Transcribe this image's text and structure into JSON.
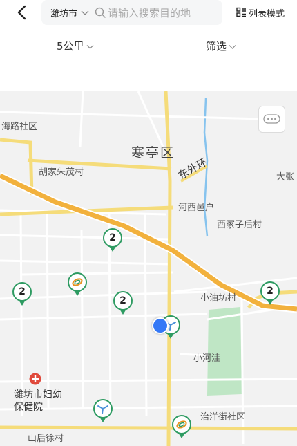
{
  "header": {
    "city": "潍坊市",
    "search_placeholder": "请输入搜索目的地",
    "list_mode_label": "列表模式"
  },
  "filters": {
    "distance_label": "5公里",
    "filter_label": "筛选"
  },
  "map": {
    "labels": {
      "hailu": "海路社区",
      "hanting": "寒亭区",
      "hujiazhu": "胡家朱茂村",
      "dongwaihuan": "东外环",
      "dazhang": "大张",
      "hexiyi": "河西邑户",
      "ximengzi": "西冢子后村",
      "xiaoyoufang": "小油坊村",
      "xiaohewa": "小河洼",
      "hospital": "潍坊市妇幼保健院",
      "zhiyangjie": "治洋街社区",
      "shanhouxu": "山后徐村"
    },
    "cluster_counts": [
      "2",
      "2",
      "2",
      "2"
    ],
    "colors": {
      "marker_green": "#2e9b62",
      "road_yellow": "#f5dc7a",
      "highway_orange": "#f2b13d",
      "park_green": "#bfe6c5",
      "water_blue": "#86c3ee",
      "location_blue": "#3478f6",
      "hospital_red": "#e04a3c"
    },
    "icons": [
      "charging-station-icon",
      "lightning-icon",
      "more-icon",
      "hospital-icon"
    ]
  }
}
